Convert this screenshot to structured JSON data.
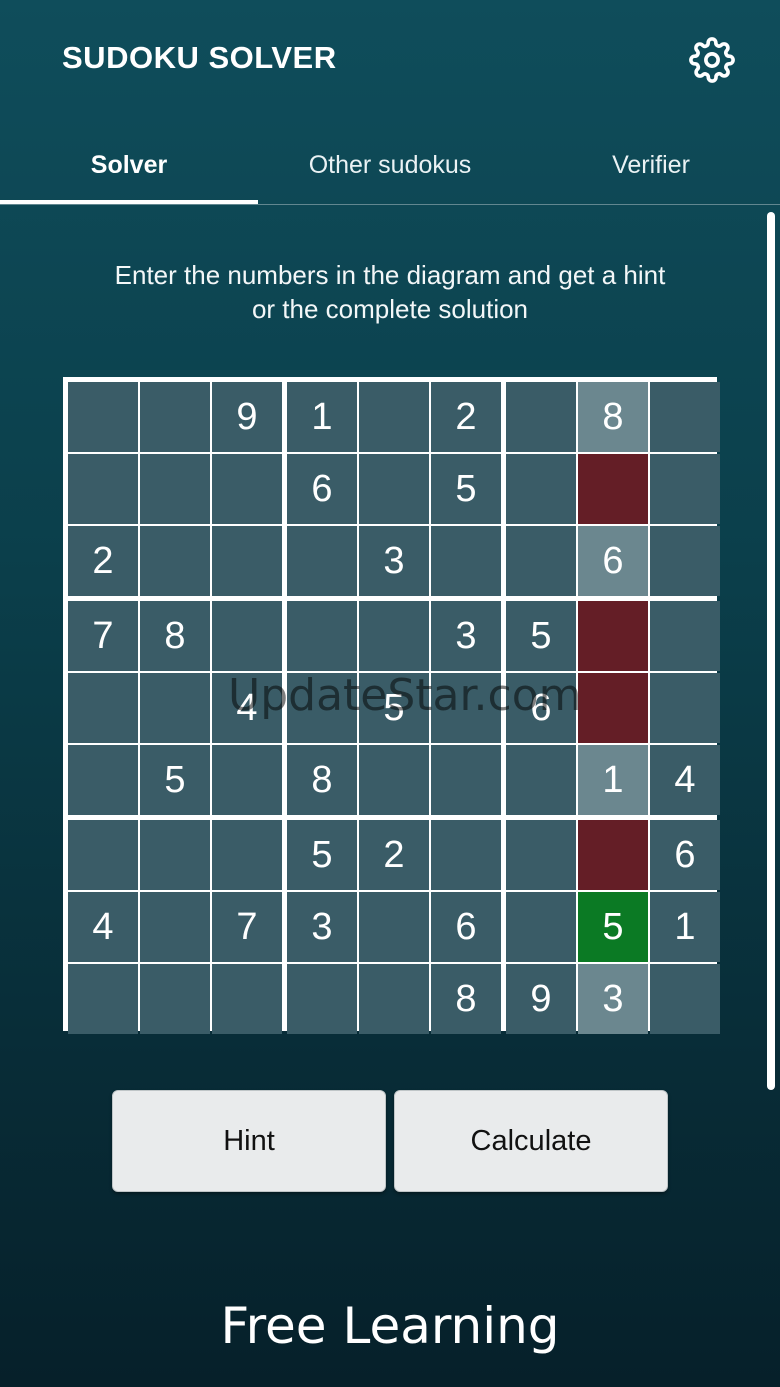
{
  "header": {
    "title": "SUDOKU SOLVER",
    "settings_icon": "gear-icon"
  },
  "tabs": [
    {
      "label": "Solver",
      "active": true
    },
    {
      "label": "Other sudokus",
      "active": false
    },
    {
      "label": "Verifier",
      "active": false
    }
  ],
  "instructions": {
    "line1": "Enter the numbers in the diagram and get a hint",
    "line2": "or the complete solution"
  },
  "board": {
    "grid": [
      [
        "",
        "",
        "9",
        "1",
        "",
        "2",
        "",
        "8",
        ""
      ],
      [
        "",
        "",
        "",
        "6",
        "",
        "5",
        "",
        "",
        ""
      ],
      [
        "2",
        "",
        "",
        "",
        "3",
        "",
        "",
        "6",
        ""
      ],
      [
        "7",
        "8",
        "",
        "",
        "",
        "3",
        "5",
        "",
        ""
      ],
      [
        "",
        "",
        "4",
        "",
        "5",
        "",
        "6",
        "",
        ""
      ],
      [
        "",
        "5",
        "",
        "8",
        "",
        "",
        "",
        "1",
        "4"
      ],
      [
        "",
        "",
        "",
        "5",
        "2",
        "",
        "",
        "",
        "6"
      ],
      [
        "4",
        "",
        "7",
        "3",
        "",
        "6",
        "",
        "5",
        "1"
      ],
      [
        "",
        "",
        "",
        "",
        "",
        "8",
        "9",
        "3",
        ""
      ]
    ],
    "highlighted_column": 7,
    "error_cells": [
      [
        1,
        7
      ],
      [
        3,
        7
      ],
      [
        4,
        7
      ],
      [
        6,
        7
      ]
    ],
    "correct_cells": [
      [
        7,
        7
      ]
    ],
    "colors": {
      "cell": "#3a5c67",
      "highlight": "#6b878f",
      "error": "#641e26",
      "correct": "#0b7a24"
    }
  },
  "buttons": {
    "hint": "Hint",
    "calculate": "Calculate"
  },
  "watermark": "UpdateStar.com",
  "brand": "Free Learning"
}
